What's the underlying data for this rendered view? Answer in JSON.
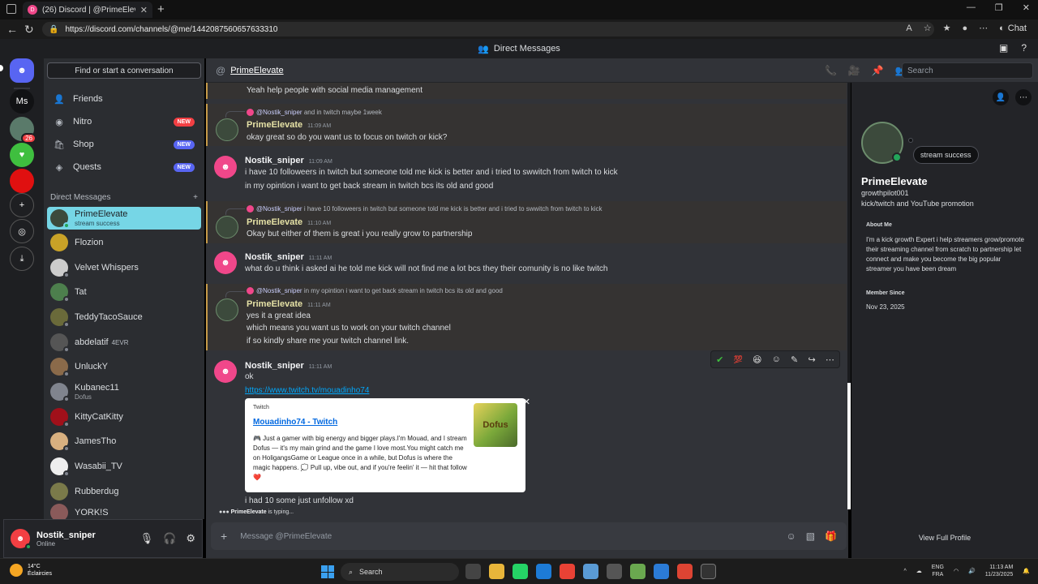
{
  "browser": {
    "tab_title": "(26) Discord | @PrimeElevate",
    "url": "https://discord.com/channels/@me/1442087560657633310",
    "chat_label": "Chat"
  },
  "discord_top": {
    "title": "Direct Messages"
  },
  "servers": {
    "unread": "26",
    "ms_label": "Ms"
  },
  "sidebar": {
    "find_placeholder": "Find or start a conversation",
    "nav": [
      {
        "label": "Friends"
      },
      {
        "label": "Nitro",
        "badge": "NEW"
      },
      {
        "label": "Shop",
        "badge": "NEW"
      },
      {
        "label": "Quests",
        "badge": "NEW"
      }
    ],
    "dm_header": "Direct Messages",
    "dms": [
      {
        "name": "PrimeElevate",
        "sub": "stream success"
      },
      {
        "name": "Flozion"
      },
      {
        "name": "Velvet Whispers"
      },
      {
        "name": "Tat"
      },
      {
        "name": "TeddyTacoSauce"
      },
      {
        "name": "abdelatif",
        "tag": "4EVR"
      },
      {
        "name": "UnluckY"
      },
      {
        "name": "Kubanec11",
        "sub": "Dofus"
      },
      {
        "name": "KittyCatKitty"
      },
      {
        "name": "JamesTho"
      },
      {
        "name": "Wasabii_TV"
      },
      {
        "name": "Rubberdug"
      },
      {
        "name": "YORK!S"
      }
    ]
  },
  "user_panel": {
    "name": "Nostik_sniper",
    "status": "Online"
  },
  "chat_header": {
    "name": "PrimeElevate",
    "search_placeholder": "Search"
  },
  "messages": {
    "m0": {
      "text": "Yeah help people with social media management"
    },
    "m1": {
      "reply_user": "@Nostik_sniper",
      "reply_text": "and in twitch maybe 1week",
      "author": "PrimeElevate",
      "time": "11:09 AM",
      "text": "okay great so do you want us to focus on twitch or kick?"
    },
    "m2": {
      "author": "Nostik_sniper",
      "time": "11:09 AM",
      "line1": "i have 10 followeers in twitch but someone told me kick is better and i tried to swwitch from twitch to kick",
      "line2": "in my opintion i want to get back stream in twitch bcs its old and good"
    },
    "m3": {
      "reply_user": "@Nostik_sniper",
      "reply_text": "i have 10 followeers in twitch but someone told me kick is better and i tried to swwitch from twitch to kick",
      "author": "PrimeElevate",
      "time": "11:10 AM",
      "text": "Okay but either of them is great i you really grow to partnership"
    },
    "m4": {
      "author": "Nostik_sniper",
      "time": "11:11 AM",
      "text": "what do u think i asked ai he told me kick will not find me a lot bcs they their comunity is no like twitch"
    },
    "m5": {
      "reply_user": "@Nostik_sniper",
      "reply_text": "in my opintion i want to get back stream in twitch bcs its old and good",
      "author": "PrimeElevate",
      "time": "11:11 AM",
      "line1": "yes it a great idea",
      "line2": "which means you want us to work on your twitch channel",
      "line3": "if so kindly share me your twitch channel link."
    },
    "m6": {
      "author": "Nostik_sniper",
      "time": "11:11 AM",
      "text": "ok",
      "link": "https://www.twitch.tv/mouadinho74",
      "after": "i had 10 some just unfollow xd"
    }
  },
  "embed": {
    "provider": "Twitch",
    "title": "Mouadinho74 - Twitch",
    "description": "🎮 Just a gamer with big energy and bigger plays.I'm Mouad, and I stream Dofus — it's my main grind and the game I love most.You might catch me on HoligangsGame or League once in a while, but Dofus is where the magic happens. 💭 Pull up, vibe out, and if you're feelin' it — hit that follow ❤️",
    "thumb_label": "Dofus"
  },
  "typing": {
    "name": "PrimeElevate",
    "text": "is typing..."
  },
  "composer": {
    "placeholder": "Message @PrimeElevate"
  },
  "profile": {
    "bubble": "stream success",
    "name": "PrimeElevate",
    "username": "growthpilot001",
    "pronouns": "kick/twitch and YouTube promotion",
    "about_title": "About Me",
    "about": "I'm a kick growth Expert i help streamers grow/promote their streaming channel from scratch to partnership let connect and make you become the big popular streamer you have been dream",
    "member_title": "Member Since",
    "member_date": "Nov 23, 2025",
    "view_full": "View Full Profile"
  },
  "taskbar": {
    "temp": "14°C",
    "weather": "Éclaircies",
    "search": "Search",
    "lang1": "ENG",
    "lang2": "FRA",
    "time": "11:13 AM",
    "date": "11/23/2025"
  },
  "colors": {
    "accent": "#5865f2",
    "highlight": "#c59a48",
    "active_dm": "#76d6e6",
    "link": "#00a8fc"
  }
}
